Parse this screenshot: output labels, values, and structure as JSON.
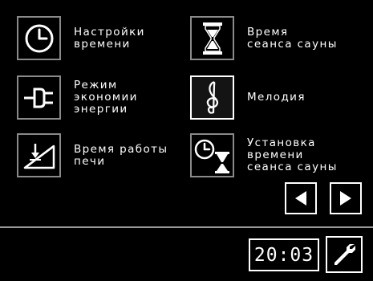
{
  "menu": {
    "time_settings": {
      "label": "Настройки\nвремени",
      "icon": "clock-icon"
    },
    "session_time": {
      "label": "Время\nсеанса сауны",
      "icon": "hourglass-icon"
    },
    "energy_saving": {
      "label": "Режим\nэкономии\nэнергии",
      "icon": "plug-icon"
    },
    "melody": {
      "label": "Мелодия",
      "icon": "treble-clef-icon"
    },
    "heater_runtime": {
      "label": "Время работы\nпечи",
      "icon": "ramp-arrow-icon"
    },
    "session_time_setup": {
      "label": "Установка\nвремени\nсеанса сауны",
      "icon": "clock-hourglass-icon"
    }
  },
  "navigation": {
    "prev_icon": "left-arrow-icon",
    "next_icon": "right-arrow-icon"
  },
  "status_bar": {
    "clock_time": "20:03",
    "settings_icon": "wrench-icon"
  },
  "colors": {
    "background": "#000000",
    "foreground": "#ffffff",
    "tile_border": "#8a8a8a"
  }
}
